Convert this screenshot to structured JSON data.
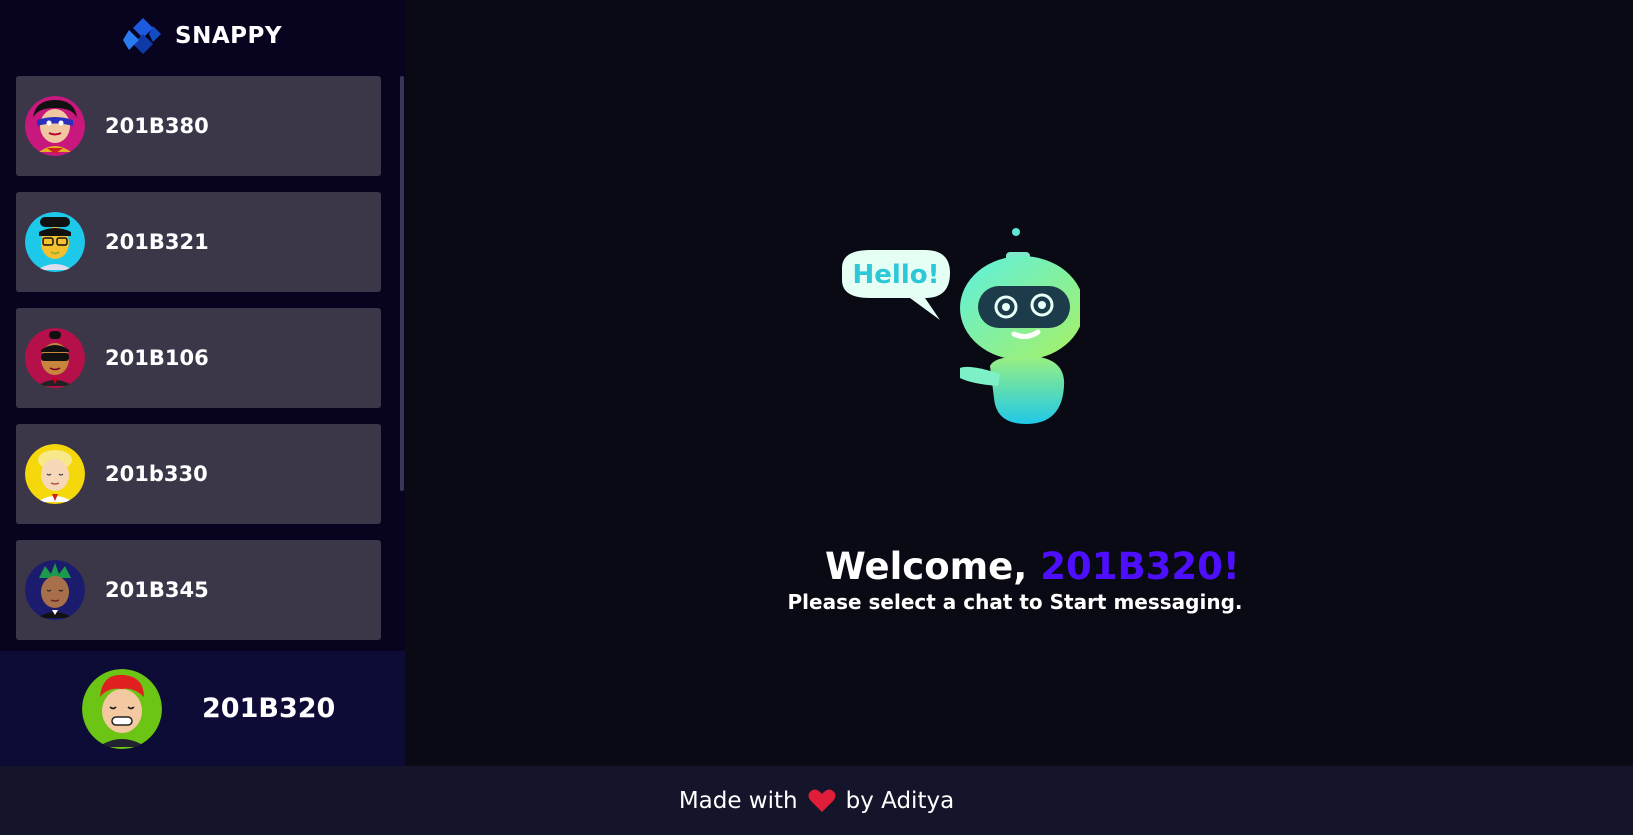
{
  "brand": {
    "name": "SNAPPY",
    "logo_icon": "snappy-logo-icon"
  },
  "contacts": [
    {
      "name": "201B380",
      "avatar_bg": "#c8187e",
      "avatar_icon": "masked-avatar"
    },
    {
      "name": "201B321",
      "avatar_bg": "#1ec8e8",
      "avatar_icon": "glasses-avatar"
    },
    {
      "name": "201B106",
      "avatar_bg": "#b5104a",
      "avatar_icon": "sunglasses-avatar"
    },
    {
      "name": "201b330",
      "avatar_bg": "#f4d80c",
      "avatar_icon": "blonde-avatar"
    },
    {
      "name": "201B345",
      "avatar_bg": "#1c1c6e",
      "avatar_icon": "green-hair-avatar"
    }
  ],
  "current_user": {
    "name": "201B320",
    "avatar_bg": "#6cc414",
    "avatar_icon": "red-hair-avatar"
  },
  "welcome": {
    "greeting": "Welcome,",
    "username": "201B320!",
    "subtitle": "Please select a chat to Start messaging.",
    "robot_bubble": "Hello!"
  },
  "footer": {
    "prefix": "Made with",
    "suffix": "by Aditya",
    "heart_icon": "heart-icon"
  },
  "colors": {
    "accent": "#4e0eff",
    "sidebar_bg": "#080420",
    "card_bg": "#3b3749",
    "main_bg": "#0a0a14"
  }
}
